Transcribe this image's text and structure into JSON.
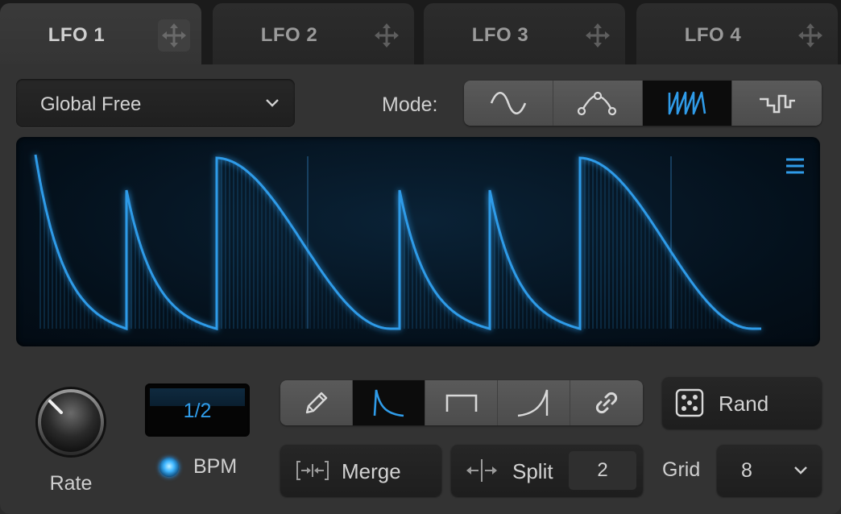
{
  "tabs": [
    {
      "label": "LFO 1",
      "active": true
    },
    {
      "label": "LFO 2",
      "active": false
    },
    {
      "label": "LFO 3",
      "active": false
    },
    {
      "label": "LFO 4",
      "active": false
    }
  ],
  "sync_dropdown": {
    "value": "Global Free"
  },
  "mode": {
    "label": "Mode:",
    "options": [
      "sine-icon",
      "curve-nodes-icon",
      "sawtooth-icon",
      "step-icon"
    ],
    "selected_index": 2
  },
  "rate": {
    "label": "Rate",
    "value": "1/2"
  },
  "bpm": {
    "label": "BPM",
    "enabled": true
  },
  "tools": {
    "options": [
      "pencil-icon",
      "decay-shape-icon",
      "square-shape-icon",
      "ramp-shape-icon",
      "link-icon"
    ],
    "selected_index": 1
  },
  "rand": {
    "label": "Rand"
  },
  "merge": {
    "label": "Merge"
  },
  "split": {
    "label": "Split",
    "value": "2"
  },
  "grid": {
    "label": "Grid",
    "value": "8"
  },
  "colors": {
    "accent": "#2f9be8",
    "display_bg": "#04101b",
    "panel": "#333333"
  }
}
